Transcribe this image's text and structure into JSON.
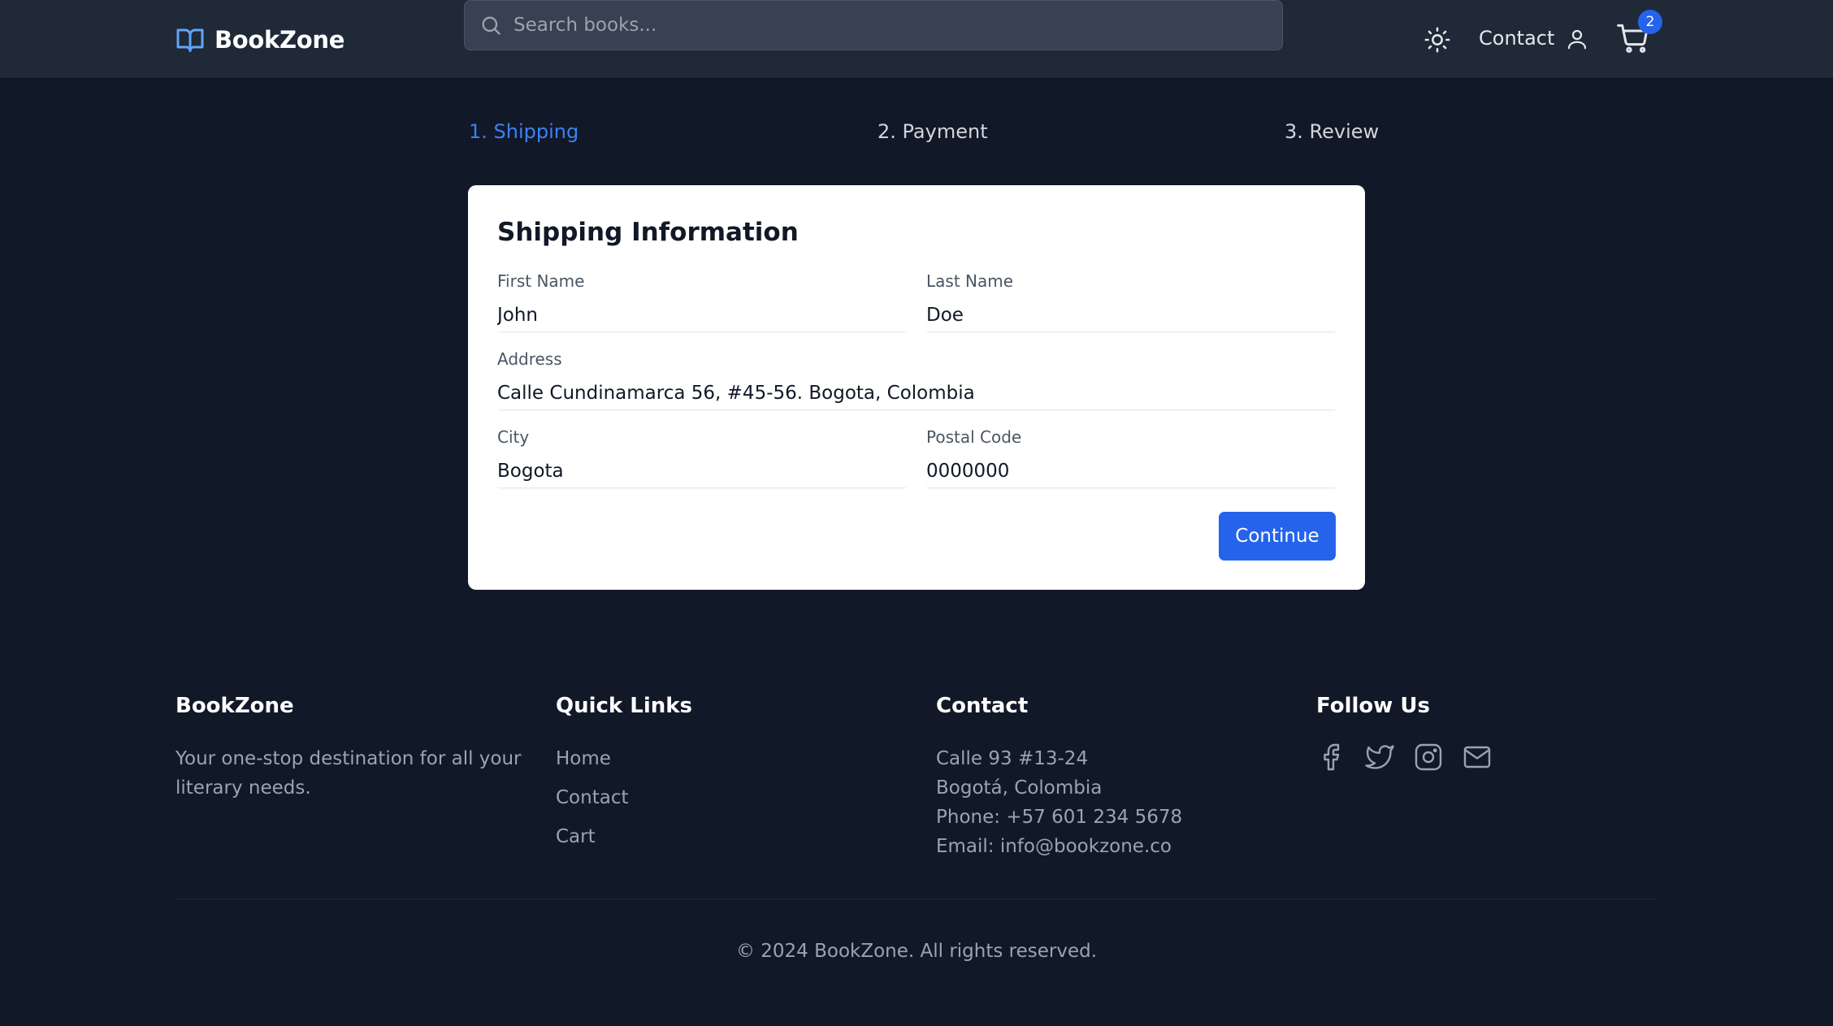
{
  "header": {
    "brand": "BookZone",
    "search_placeholder": "Search books...",
    "contact_label": "Contact",
    "cart_count": "2"
  },
  "steps": [
    {
      "label": "1. Shipping",
      "active": true
    },
    {
      "label": "2. Payment",
      "active": false
    },
    {
      "label": "3. Review",
      "active": false
    }
  ],
  "form": {
    "title": "Shipping Information",
    "first_name": {
      "label": "First Name",
      "value": "John"
    },
    "last_name": {
      "label": "Last Name",
      "value": "Doe"
    },
    "address": {
      "label": "Address",
      "value": "Calle Cundinamarca 56, #45-56. Bogota, Colombia"
    },
    "city": {
      "label": "City",
      "value": "Bogota"
    },
    "postal_code": {
      "label": "Postal Code",
      "value": "0000000"
    },
    "continue_label": "Continue"
  },
  "footer": {
    "brand_title": "BookZone",
    "brand_description": "Your one-stop destination for all your literary needs.",
    "quick_links_title": "Quick Links",
    "quick_links": [
      "Home",
      "Contact",
      "Cart"
    ],
    "contact_title": "Contact",
    "contact_lines": [
      "Calle 93 #13-24",
      "Bogotá, Colombia",
      "Phone: +57 601 234 5678",
      "Email: info@bookzone.co"
    ],
    "follow_title": "Follow Us",
    "socials": [
      "facebook-icon",
      "twitter-icon",
      "instagram-icon",
      "mail-icon"
    ],
    "copyright": "© 2024 BookZone. All rights reserved."
  },
  "colors": {
    "page_bg": "#111827",
    "header_bg": "#1f2937",
    "accent": "#2563eb",
    "active_step": "#3b82f6"
  }
}
